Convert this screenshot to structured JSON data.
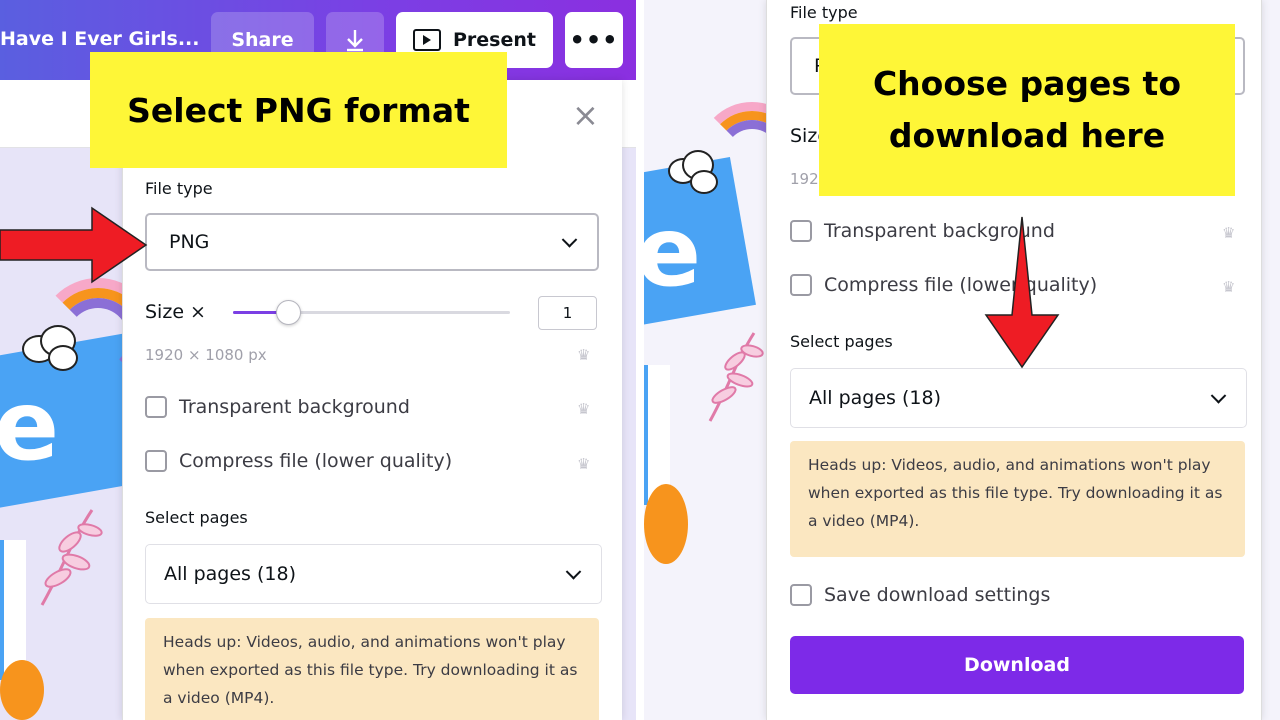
{
  "left": {
    "topbar": {
      "doc_title": "Have I Ever Girls...",
      "share_label": "Share",
      "download_icon": "download-arrow-icon",
      "present_label": "Present",
      "present_icon": "present-screen-icon",
      "more_label": "•••"
    },
    "dialog": {
      "close_icon": "×",
      "file_type_label": "File type",
      "file_type_value": "PNG",
      "size_label": "Size ×",
      "size_value": "1",
      "size_fraction": 0.2,
      "dimensions": "1920 × 1080 px",
      "transparent_label": "Transparent background",
      "compress_label": "Compress file (lower quality)",
      "crown_icon": "♛",
      "select_pages_label": "Select pages",
      "select_pages_value": "All pages (18)",
      "notice": "Heads up: Videos, audio, and animations won't play when exported as this file type. Try downloading it as a video (MP4)."
    },
    "callout": "Select PNG format",
    "accent": "#7b3fe4"
  },
  "right": {
    "dialog": {
      "file_type_label": "File type",
      "file_type_partial": "P",
      "size_partial": "Size",
      "dimensions_partial": "192",
      "transparent_label": "Transparent background",
      "compress_label": "Compress file (lower quality)",
      "crown_icon": "♛",
      "select_pages_label": "Select pages",
      "select_pages_value": "All pages (18)",
      "notice": "Heads up: Videos, audio, and animations won't play when exported as this file type. Try downloading it as a video (MP4).",
      "save_settings_label": "Save download settings",
      "download_label": "Download"
    },
    "callout": "Choose pages to download here",
    "button_color": "#7d2ae8"
  },
  "callout_color": "#fef637",
  "arrow_color": "#ee1c24"
}
